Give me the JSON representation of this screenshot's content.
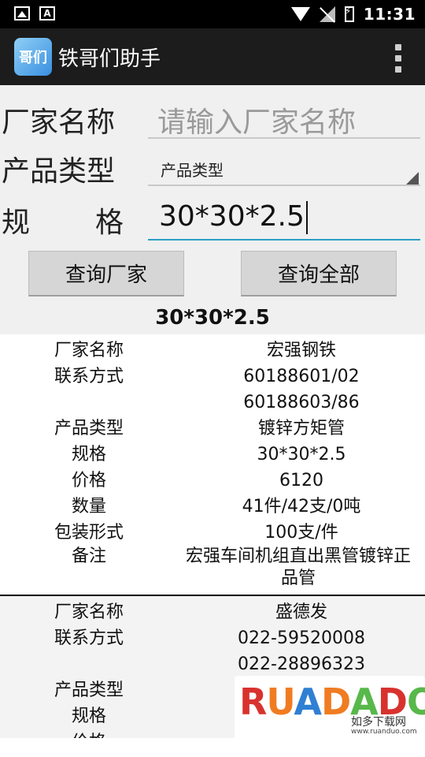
{
  "status_bar": {
    "time": "11:31",
    "left_icons": [
      "image-icon",
      "a-notification-icon"
    ],
    "right_icons": [
      "wifi-icon",
      "no-signal-icon",
      "battery-charging-icon"
    ]
  },
  "action_bar": {
    "app_icon_text": "哥们",
    "title": "铁哥们助手",
    "overflow_icon": "more-vert-icon"
  },
  "form": {
    "manufacturer": {
      "label": "厂家名称",
      "placeholder": "请输入厂家名称",
      "value": ""
    },
    "product_type": {
      "label": "产品类型",
      "selected": "产品类型"
    },
    "spec": {
      "label_chars": [
        "规",
        "格"
      ],
      "value": "30*30*2.5"
    },
    "buttons": {
      "query_manufacturer": "查询厂家",
      "query_all": "查询全部"
    },
    "query_title": "30*30*2.5"
  },
  "results": [
    {
      "rows": [
        {
          "key": "厂家名称",
          "value": "宏强钢铁"
        },
        {
          "key": "联系方式",
          "value": "60188601/02"
        },
        {
          "key": "",
          "value": "60188603/86"
        },
        {
          "key": "产品类型",
          "value": "镀锌方矩管"
        },
        {
          "key": "规格",
          "value": "30*30*2.5"
        },
        {
          "key": "价格",
          "value": "6120"
        },
        {
          "key": "数量",
          "value": "41件/42支/0吨"
        },
        {
          "key": "包装形式",
          "value": "100支/件"
        },
        {
          "key": "备注",
          "value": "宏强车间机组直出黑管镀锌正品管"
        }
      ]
    },
    {
      "rows": [
        {
          "key": "厂家名称",
          "value": "盛德发"
        },
        {
          "key": "联系方式",
          "value": "022-59520008"
        },
        {
          "key": "",
          "value": "022-28896323"
        },
        {
          "key": "产品类型",
          "value": ""
        },
        {
          "key": "规格",
          "value": ""
        },
        {
          "key": "价格",
          "value": ""
        }
      ]
    }
  ],
  "watermark": {
    "brand": "RUANDADO",
    "subtitle": "如多下载网",
    "url": "www.ruanduo.com"
  },
  "colors": {
    "status_bar": "#000000",
    "action_bar": "#1c1c1c",
    "input_focus": "#2b9fc5",
    "background": "#f0f0f0"
  }
}
